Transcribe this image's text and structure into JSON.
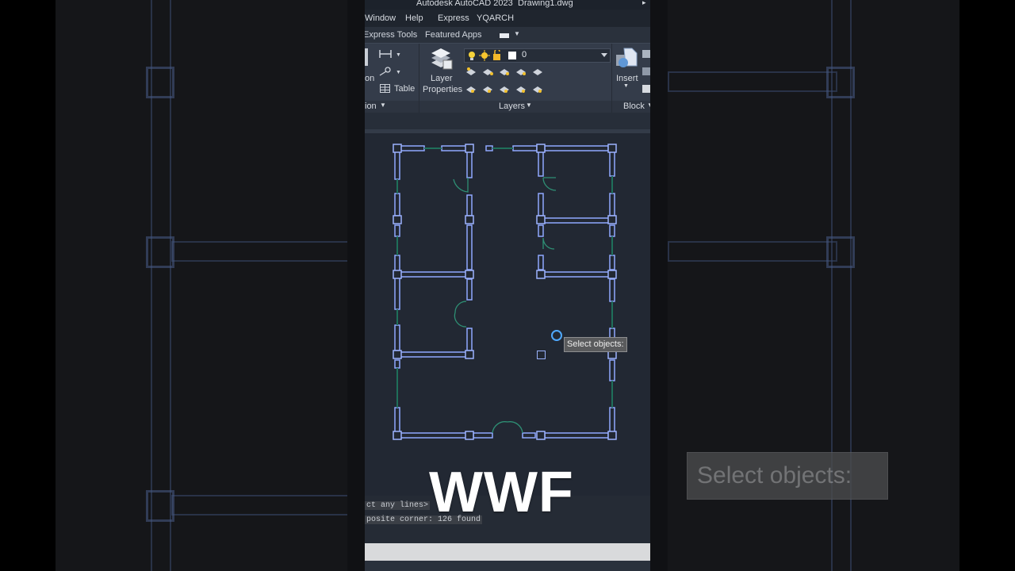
{
  "app": {
    "title": "Autodesk AutoCAD 2023",
    "document": "Drawing1.dwg"
  },
  "menu": {
    "items": [
      "Window",
      "Help",
      "Express",
      "YQARCH"
    ]
  },
  "ribbon_tabs": {
    "express_tools": "Express Tools",
    "featured_apps": "Featured Apps"
  },
  "ribbon": {
    "annotation_partial": "on",
    "table_label": "Table",
    "layer_properties_line1": "Layer",
    "layer_properties_line2": "Properties",
    "current_layer": "0",
    "layers_panel": "Layers",
    "annotation_panel_partial": "ion",
    "insert_label": "Insert",
    "block_panel": "Block"
  },
  "tooltip": {
    "text": "Select objects:"
  },
  "command_history": {
    "line1": "ct any lines>",
    "line2": "posite corner: 126 found"
  },
  "overlay": {
    "text": "WWF"
  },
  "background_tooltip": {
    "text": "Select objects:"
  },
  "colors": {
    "wall_outline": "#8fa8ff",
    "window_line": "#1f6f5a",
    "door_arc": "#2e8f74",
    "viewport_bg": "#222833",
    "ribbon_bg": "#343c4a"
  }
}
